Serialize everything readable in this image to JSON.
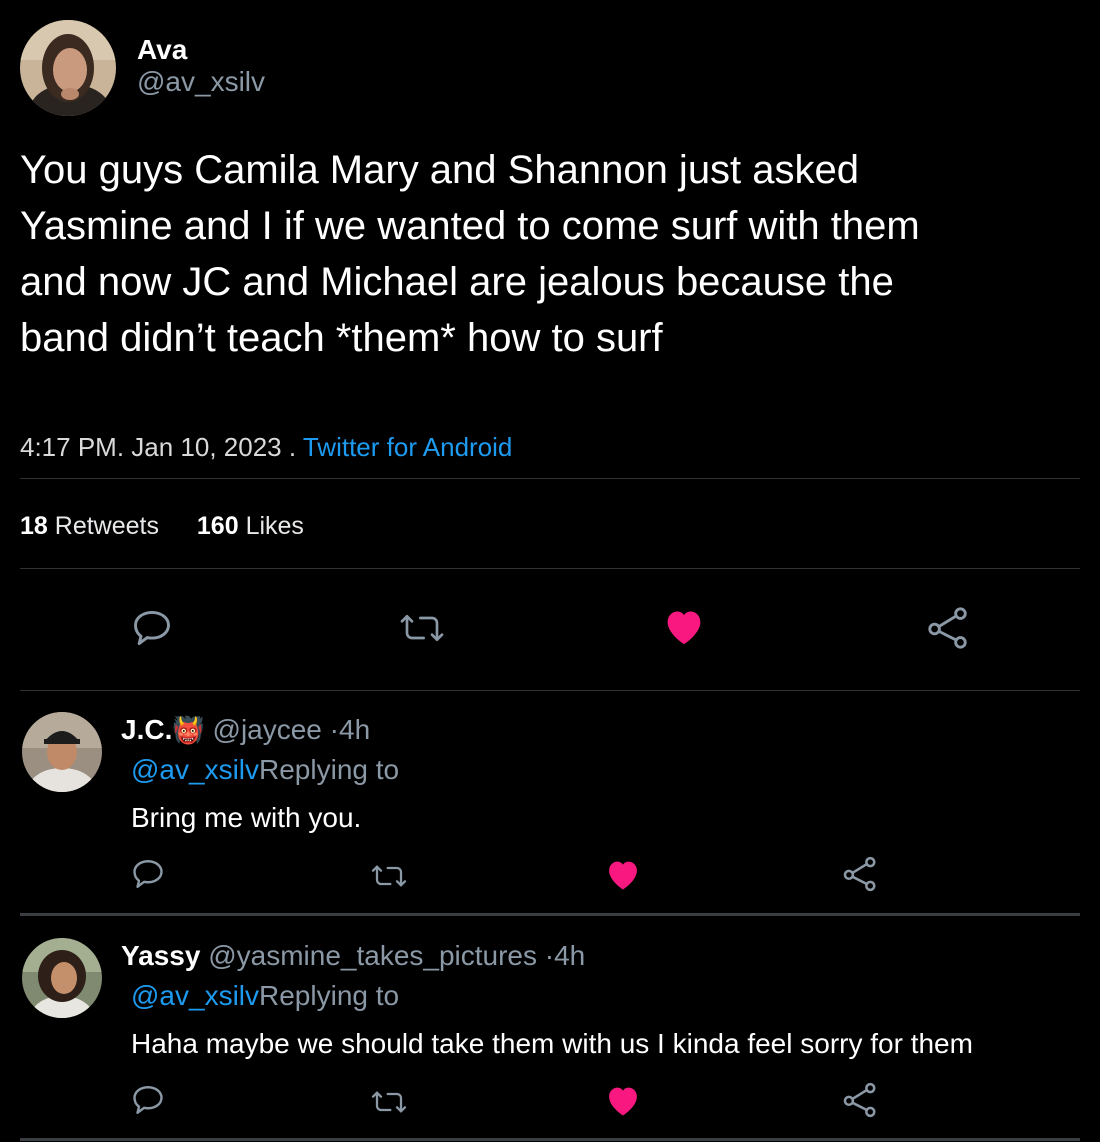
{
  "tweet": {
    "author_name": "Ava",
    "author_handle": "@av_xsilv",
    "text_lines": [
      "You guys Camila Mary and Shannon just asked",
      "Yasmine and I if we wanted to come surf with them",
      "and now JC and Michael are jealous because the",
      "band didn’t teach *them* how to surf"
    ],
    "time": "4:17 PM",
    "date": ". Jan 10, 2023 .",
    "source": "Twitter for Android",
    "retweet_count": "18",
    "retweet_label": "Retweets",
    "like_count": "160",
    "like_label": "Likes",
    "liked": true
  },
  "colors": {
    "background": "#000000",
    "link": "#1d9bf0",
    "like": "#f91880",
    "muted": "#8b98a5"
  },
  "icons": [
    "reply-icon",
    "retweet-icon",
    "like-heart-icon",
    "share-icon",
    "devil-emoji-icon"
  ],
  "replies": [
    {
      "name": "J.C.",
      "emoji": "👹",
      "handle": "@jaycee",
      "time": "·4h",
      "mention": "@av_xsilv",
      "replying_label": "Replying to",
      "text": "Bring me with you.",
      "liked": true
    },
    {
      "name": "Yassy",
      "handle": "@yasmine_takes_pictures",
      "time": "·4h",
      "mention": "@av_xsilv",
      "replying_label": "Replying to",
      "text": "Haha maybe we should take them with us I kinda feel sorry for them",
      "liked": true
    }
  ]
}
